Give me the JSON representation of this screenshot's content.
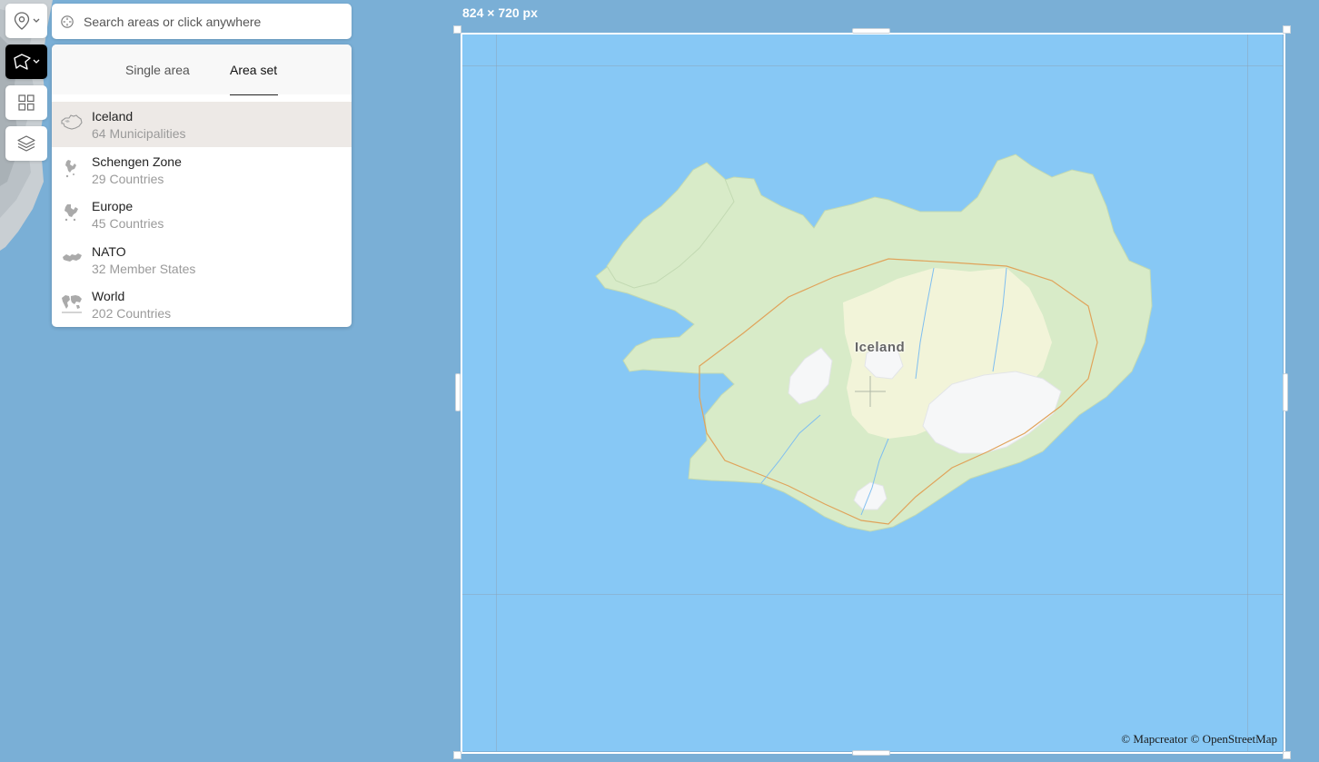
{
  "map": {
    "frame_size_label": "824 × 720 px",
    "place_label": "Iceland",
    "attribution": "© Mapcreator © OpenStreetMap"
  },
  "toolbar": {
    "items": [
      {
        "icon": "location-pin-icon",
        "has_dropdown": true,
        "active": false
      },
      {
        "icon": "polygon-area-icon",
        "has_dropdown": true,
        "active": true
      },
      {
        "icon": "grid-icon",
        "has_dropdown": false,
        "active": false
      },
      {
        "icon": "layers-icon",
        "has_dropdown": false,
        "active": false
      }
    ]
  },
  "search": {
    "placeholder": "Search areas or click anywhere",
    "value": ""
  },
  "panel": {
    "tabs": [
      {
        "label": "Single area",
        "active": false
      },
      {
        "label": "Area set",
        "active": true
      }
    ],
    "items": [
      {
        "name": "Iceland",
        "count": "64 Municipalities",
        "selected": true,
        "icon": "iceland-shape-icon"
      },
      {
        "name": "Schengen Zone",
        "count": "29 Countries",
        "selected": false,
        "icon": "schengen-shape-icon"
      },
      {
        "name": "Europe",
        "count": "45 Countries",
        "selected": false,
        "icon": "europe-shape-icon"
      },
      {
        "name": "NATO",
        "count": "32 Member States",
        "selected": false,
        "icon": "nato-shape-icon"
      },
      {
        "name": "World",
        "count": "202 Countries",
        "selected": false,
        "icon": "world-shape-icon"
      }
    ]
  },
  "colors": {
    "ocean_outside": "#7aafd6",
    "ocean_frame": "#87c8f5",
    "land": "#d8ebc8",
    "highland": "#f3f4da",
    "glacier": "#f6f7f8",
    "selected_row": "#ede9e6",
    "active_tool": "#000000"
  }
}
